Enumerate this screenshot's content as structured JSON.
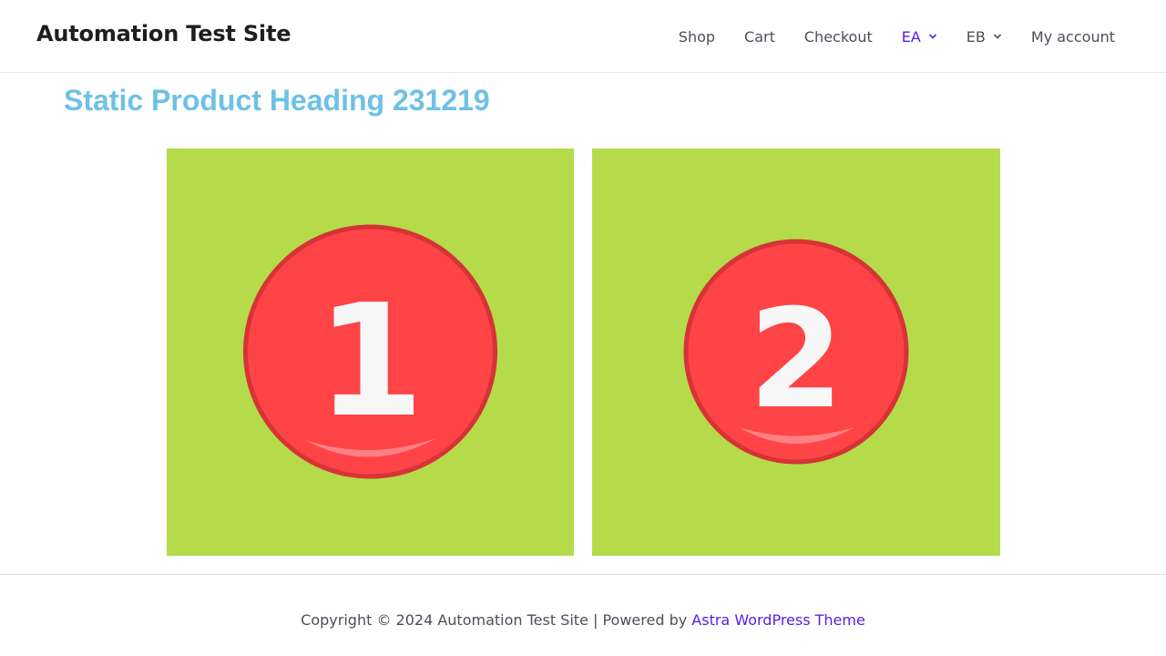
{
  "header": {
    "site_title": "Automation Test Site",
    "nav": [
      {
        "label": "Shop",
        "dropdown": false,
        "active": false
      },
      {
        "label": "Cart",
        "dropdown": false,
        "active": false
      },
      {
        "label": "Checkout",
        "dropdown": false,
        "active": false
      },
      {
        "label": "EA",
        "dropdown": true,
        "active": true
      },
      {
        "label": "EB",
        "dropdown": true,
        "active": false
      },
      {
        "label": "My account",
        "dropdown": false,
        "active": false
      }
    ]
  },
  "main": {
    "heading": "Static Product Heading 231219",
    "images": [
      {
        "digit": "1",
        "icon": "number-one-badge-icon"
      },
      {
        "digit": "2",
        "icon": "number-two-badge-icon"
      }
    ]
  },
  "footer": {
    "copyright": "Copyright © 2024 Automation Test Site | Powered by ",
    "link_label": "Astra WordPress Theme"
  },
  "colors": {
    "accent": "#5b1de0",
    "heading": "#6ec1e4",
    "image_bg": "#b5db4a",
    "badge_red": "#ff4447",
    "badge_ring": "#d63337"
  }
}
